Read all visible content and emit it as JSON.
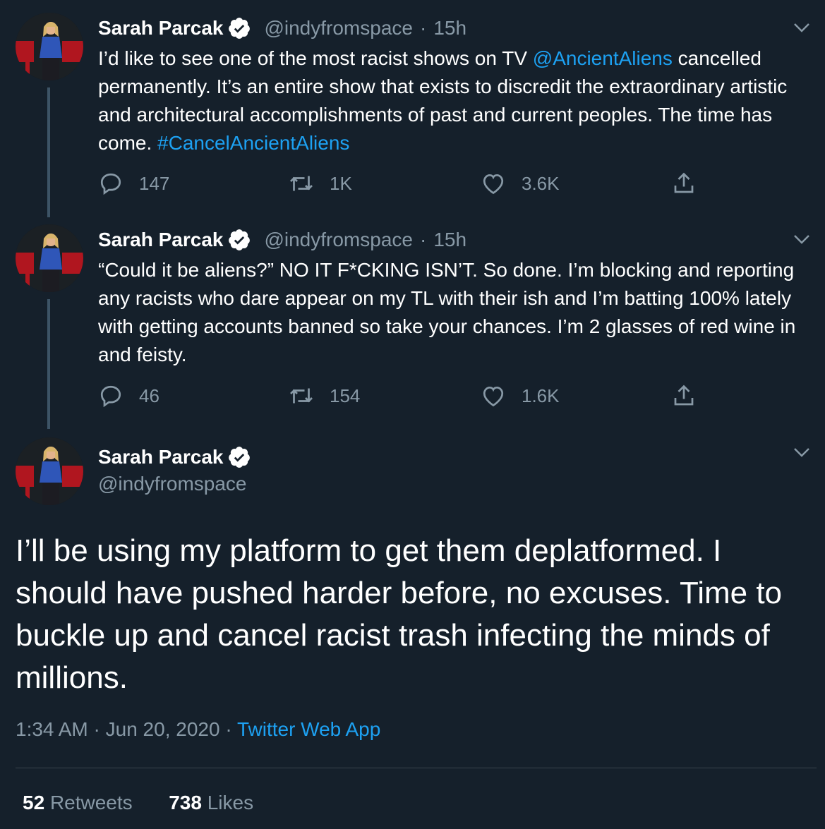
{
  "colors": {
    "background": "#15202b",
    "text_primary": "#ffffff",
    "text_secondary": "#8899a6",
    "link": "#1da1f2",
    "verified": "#ffffff",
    "thread_line": "#3d5466"
  },
  "tweets": [
    {
      "name": "Sarah Parcak",
      "handle": "@indyfromspace",
      "separator": "·",
      "time": "15h",
      "text_parts": {
        "a": "I’d like to see one of the most racist shows on TV ",
        "b": "@AncientAliens",
        "c": " cancelled permanently. It’s an entire show that exists to discredit the extraordinary artistic and architectural accomplishments of past and current peoples. The time has come. ",
        "d": "#CancelAncientAliens"
      },
      "replies": "147",
      "retweets": "1K",
      "likes": "3.6K",
      "icons": [
        "reply-icon",
        "retweet-icon",
        "like-icon",
        "share-icon",
        "chevron-down-icon",
        "verified-badge-icon"
      ]
    },
    {
      "name": "Sarah Parcak",
      "handle": "@indyfromspace",
      "separator": "·",
      "time": "15h",
      "text": "“Could it be aliens?” NO IT F*CKING ISN’T. So done. I’m blocking and reporting any racists who dare appear on my TL with their ish and I’m batting 100% lately with getting accounts banned so take your chances. I’m 2 glasses of red wine in and feisty.",
      "replies": "46",
      "retweets": "154",
      "likes": "1.6K"
    }
  ],
  "main_tweet": {
    "name": "Sarah Parcak",
    "handle": "@indyfromspace",
    "text": "I’ll be using my platform to get them deplatformed. I should have pushed harder before, no excuses. Time to buckle up and cancel racist trash infecting the minds of millions.",
    "time": "1:34 AM",
    "separator": "·",
    "date": "Jun 20, 2020",
    "source": "Twitter Web App",
    "retweets_count": "52",
    "retweets_label": "Retweets",
    "likes_count": "738",
    "likes_label": "Likes"
  }
}
